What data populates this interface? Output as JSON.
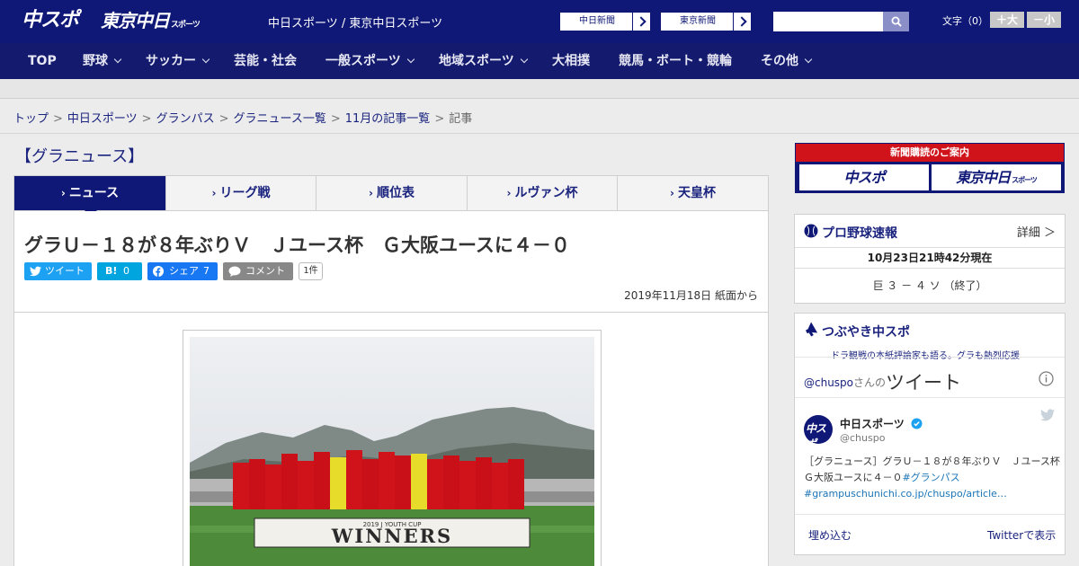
{
  "header": {
    "logo_main": "中スポ",
    "logo_tokyo": "東京中日",
    "logo_tokyo_small": "スポーツ",
    "site_name": "中日スポーツ / 東京中日スポーツ",
    "newspaper_buttons": [
      "中日新聞",
      "東京新聞"
    ],
    "font_size_label": "文字（0）",
    "font_larger": "＋大",
    "font_smaller": "－小"
  },
  "nav": {
    "items": [
      {
        "label": "TOP"
      },
      {
        "label": "野球"
      },
      {
        "label": "サッカー"
      },
      {
        "label": "芸能・社会"
      },
      {
        "label": "一般スポーツ"
      },
      {
        "label": "地域スポーツ"
      },
      {
        "label": "大相撲"
      },
      {
        "label": "競馬・ボート・競輪"
      },
      {
        "label": "その他"
      }
    ]
  },
  "breadcrumb": {
    "items": [
      "トップ",
      "中日スポーツ",
      "グランパス",
      "グラニュース一覧",
      "11月の記事一覧"
    ],
    "current": "記事",
    "separator": ">"
  },
  "section": {
    "title": "【グラニュース】"
  },
  "tabs": [
    "ニュース",
    "リーグ戦",
    "順位表",
    "ルヴァン杯",
    "天皇杯"
  ],
  "article": {
    "headline": "グラＵ－１８が８年ぶりＶ　Ｊユース杯　Ｇ大阪ユースに４－０",
    "share": {
      "tweet": "ツイート",
      "hatena": "B!",
      "hatena_count": "0",
      "facebook": "シェア",
      "facebook_count": "7",
      "comment": "コメント",
      "comment_count": "1件"
    },
    "date": "2019年11月18日 紙面から",
    "photo_banner_small": "2019 J YOUTH CUP",
    "photo_banner": "WINNERS"
  },
  "sidebar": {
    "subscribe": {
      "header": "新聞購読のご案内",
      "chuspo": "中スポ",
      "tokyo": "東京中日",
      "tokyo_small": "スポーツ"
    },
    "baseball": {
      "title": "プロ野球速報",
      "detail": "詳細 ＞",
      "timestamp": "10月23日21時42分現在",
      "score": "巨 ３ － ４ ソ （終了）"
    },
    "twitter": {
      "title": "つぶやき中スポ",
      "subtitle": "ドラ観戦の本紙評論家も語る。グラも熱烈応援",
      "handle": "@chuspo",
      "handle_suffix": "さんの",
      "tweets_label": "ツイート",
      "account_name": "中日スポーツ",
      "account_id": "@chuspo",
      "tweet_text": "［グラニュース］グラＵ－１８が８年ぶりＶ　Ｊユース杯　Ｇ大阪ユースに４－０",
      "tweet_hashtag": "#グランパス",
      "tweet_link": "#grampuschunichi.co.jp/chuspo/article…",
      "embed": "埋め込む",
      "view_on": "Twitterで表示"
    }
  },
  "colors": {
    "brand_navy": "#0f1876",
    "nav_navy": "#141b6e",
    "accent_red": "#d0121b",
    "twitter_blue": "#1da1f2",
    "facebook_blue": "#1877f2",
    "hatena_blue": "#00a4de"
  }
}
